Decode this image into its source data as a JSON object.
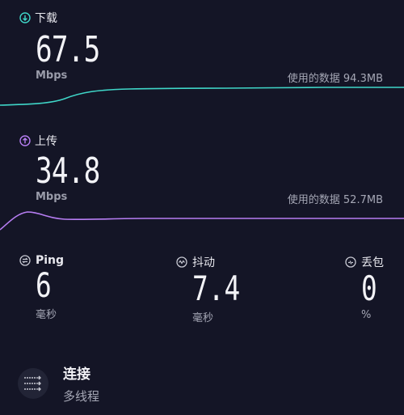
{
  "download": {
    "label": "下载",
    "value": "67.5",
    "unit": "Mbps",
    "data_used": "使用的数据 94.3MB",
    "color": "#3fd6c8"
  },
  "upload": {
    "label": "上传",
    "value": "34.8",
    "unit": "Mbps",
    "data_used": "使用的数据 52.7MB",
    "color": "#b67df2"
  },
  "ping": {
    "label": "Ping",
    "value": "6",
    "unit": "毫秒"
  },
  "jitter": {
    "label": "抖动",
    "value": "7.4",
    "unit": "毫秒"
  },
  "loss": {
    "label": "丢包",
    "value": "0",
    "unit": "%"
  },
  "connection": {
    "title": "连接",
    "subtitle": "多线程"
  }
}
